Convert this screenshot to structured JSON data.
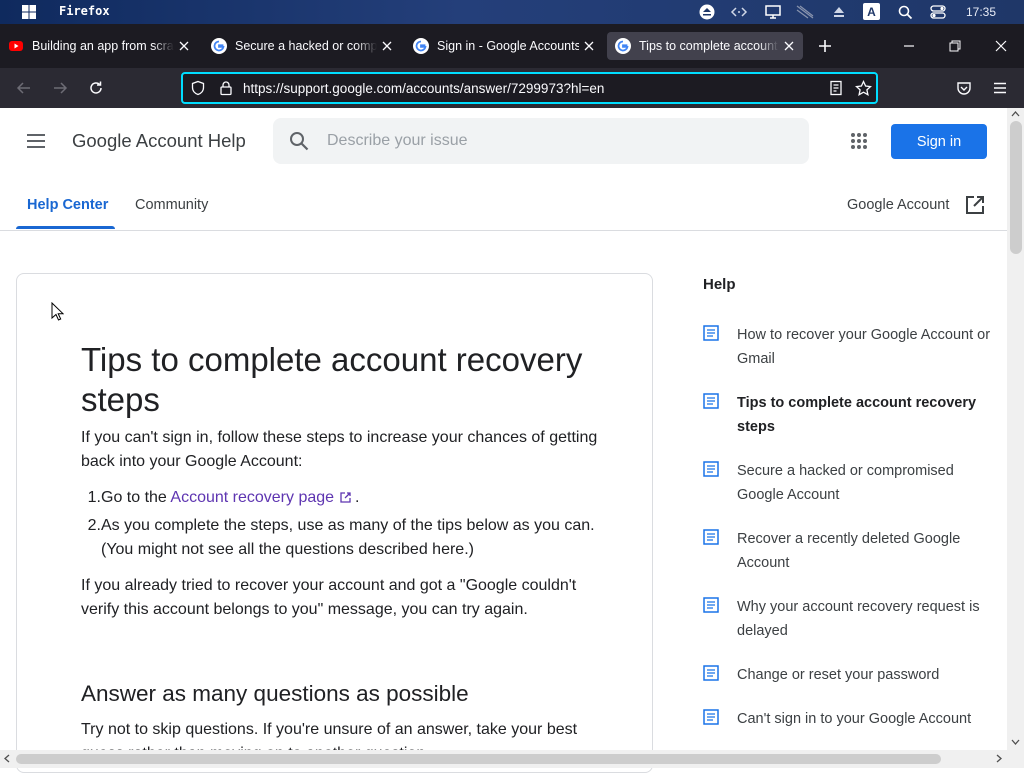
{
  "os": {
    "app_name": "Firefox",
    "clock": "17:35",
    "tray_badge": "A"
  },
  "browser": {
    "tabs": [
      {
        "title": "Building an app from scratch",
        "icon": "youtube-icon",
        "active": false
      },
      {
        "title": "Secure a hacked or compromised Google Account",
        "icon": "google-icon",
        "active": false
      },
      {
        "title": "Sign in - Google Accounts",
        "icon": "google-icon",
        "active": false
      },
      {
        "title": "Tips to complete account recovery steps",
        "icon": "google-icon",
        "active": true
      }
    ],
    "url": "https://support.google.com/accounts/answer/7299973?hl=en"
  },
  "header": {
    "title": "Google Account Help",
    "search_placeholder": "Describe your issue",
    "signin_label": "Sign in",
    "nav": [
      {
        "label": "Help Center",
        "active": true
      },
      {
        "label": "Community",
        "active": false
      }
    ],
    "account_link": "Google Account"
  },
  "article": {
    "title": "Tips to complete account recovery steps",
    "intro": "If you can't sign in, follow these steps to increase your chances of getting back into your Google Account:",
    "steps": [
      {
        "num": "1.",
        "prefix": "Go to the ",
        "link": "Account recovery page",
        "suffix": "."
      },
      {
        "num": "2.",
        "text": "As you complete the steps, use as many of the tips below as you can. (You might not see all the questions described here.)"
      }
    ],
    "retry": "If you already tried to recover your account and got a \"Google couldn't verify this account belongs to you\" message, you can try again.",
    "section_heading": "Answer as many questions as possible",
    "section_para": "Try not to skip questions. If you're unsure of an answer, take your best guess rather than moving on to another question."
  },
  "sidebar": {
    "heading": "Help",
    "items": [
      {
        "label": "How to recover your Google Account or Gmail",
        "current": false
      },
      {
        "label": "Tips to complete account recovery steps",
        "current": true
      },
      {
        "label": "Secure a hacked or compromised Google Account",
        "current": false
      },
      {
        "label": "Recover a recently deleted Google Account",
        "current": false
      },
      {
        "label": "Why your account recovery request is delayed",
        "current": false
      },
      {
        "label": "Change or reset your password",
        "current": false
      },
      {
        "label": "Can't sign in to your Google Account",
        "current": false
      }
    ]
  },
  "colors": {
    "accent": "#1a73e8",
    "link_visited": "#5e35b1",
    "focus_ring": "#00ddff"
  }
}
